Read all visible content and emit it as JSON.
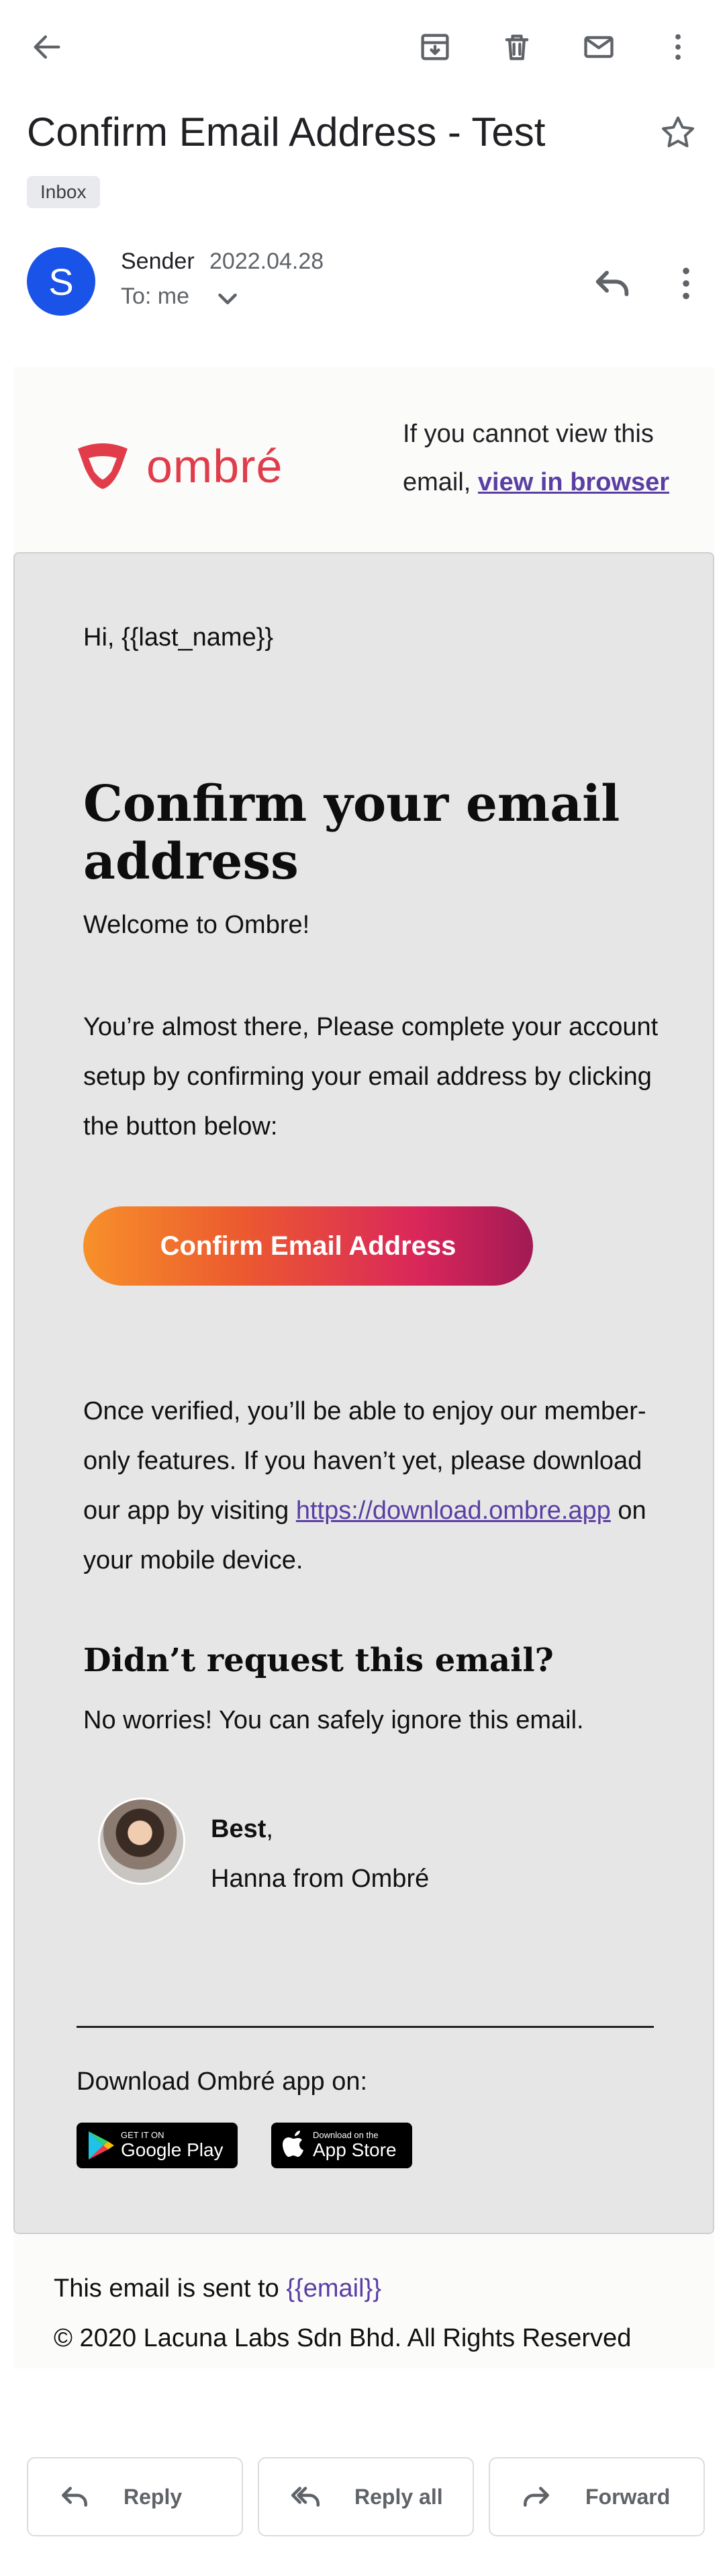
{
  "appbar": {
    "back_icon": "arrow-left-icon",
    "archive_icon": "archive-icon",
    "delete_icon": "trash-icon",
    "mark_unread_icon": "mail-icon",
    "more_icon": "more-vert-icon"
  },
  "message": {
    "subject": "Confirm Email Address - Test",
    "label": "Inbox",
    "sender_initial": "S",
    "sender_name": "Sender",
    "date": "2022.04.28",
    "to": "To: me"
  },
  "email": {
    "brand_name": "ombré",
    "view_prefix": "If you cannot view this email, ",
    "view_link": "view in browser",
    "greeting": "Hi, {{last_name}}",
    "heading": "Confirm your email address",
    "welcome": "Welcome to Ombre!",
    "intro": "You’re almost there, Please complete your account setup by confirming your email address by clicking the button below:",
    "cta_label": "Confirm Email Address",
    "verified_prefix": "Once verified, you’ll be able to enjoy our member-only features. If you haven’t yet, please download our app by visiting ",
    "download_link": "https://download.ombre.app",
    "verified_suffix": " on your mobile device.",
    "not_requested_heading": "Didn’t request this email?",
    "not_requested_text": "No worries! You can safely ignore this email.",
    "sign_best": "Best",
    "sign_comma": ",",
    "sign_name": "Hanna from Ombré",
    "download_app": "Download Ombré app on:",
    "google_play_small": "GET IT ON",
    "google_play_big": "Google Play",
    "app_store_small": "Download on the",
    "app_store_big": "App Store",
    "sent_to_prefix": "This email is sent to ",
    "sent_to_var": "{{email}}",
    "copyright": "© 2020 Lacuna Labs Sdn Bhd. All Rights Reserved"
  },
  "actions": {
    "reply": "Reply",
    "reply_all": "Reply all",
    "forward": "Forward"
  },
  "colors": {
    "brand_red": "#e03c4a",
    "link_purple": "#5a3fa3",
    "avatar_blue": "#1a53e8",
    "cta_gradient_start": "#f7902a",
    "cta_gradient_end": "#a21a54"
  }
}
